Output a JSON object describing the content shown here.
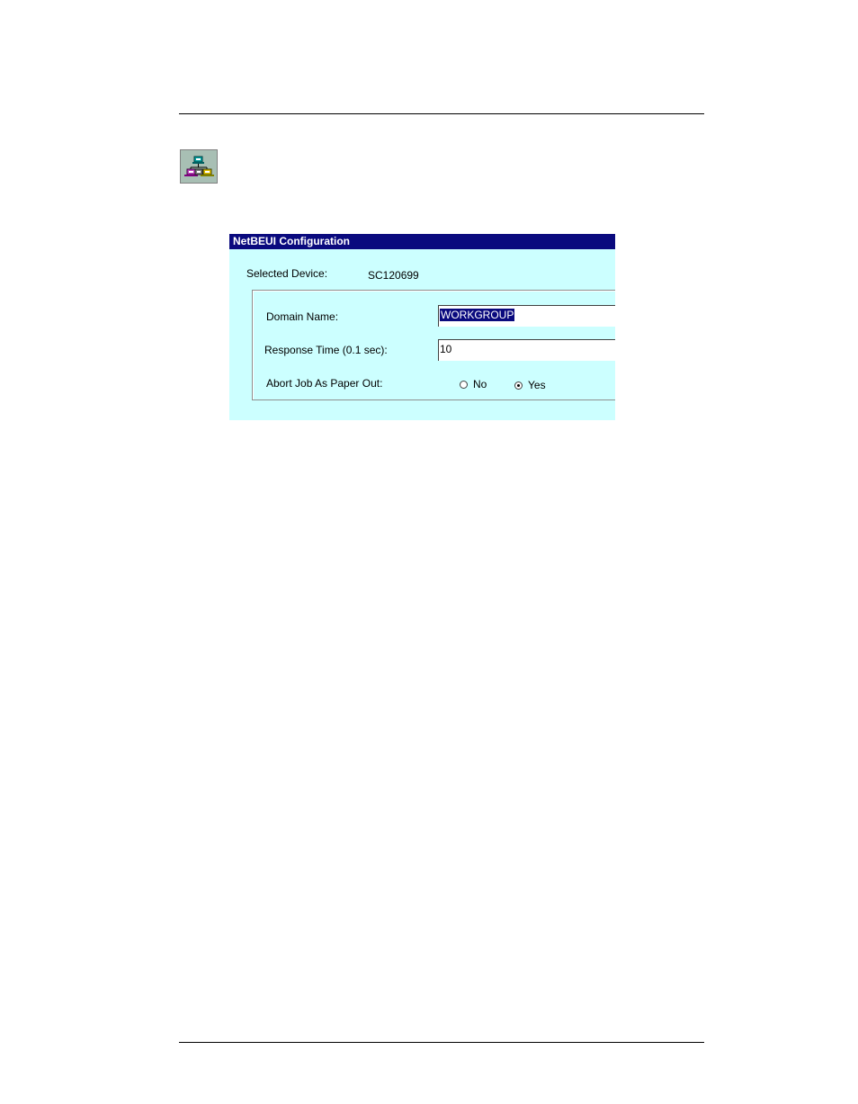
{
  "dialog": {
    "title": "NetBEUI Configuration",
    "selected_device_label": "Selected Device:",
    "selected_device_value": "SC120699",
    "domain_name": {
      "label": "Domain Name:",
      "value": "WORKGROUP"
    },
    "response_time": {
      "label": "Response Time (0.1 sec):",
      "value": "10"
    },
    "abort_job": {
      "label": "Abort Job As Paper Out:",
      "options": [
        {
          "label": "No",
          "checked": false
        },
        {
          "label": "Yes",
          "checked": true
        }
      ]
    }
  },
  "icons": {
    "toolbar_icon": "network-config-icon"
  },
  "colors": {
    "titlebar": "#0a0a7e",
    "dialog_bg": "#ccffff",
    "selection": "#0a0a7e"
  }
}
